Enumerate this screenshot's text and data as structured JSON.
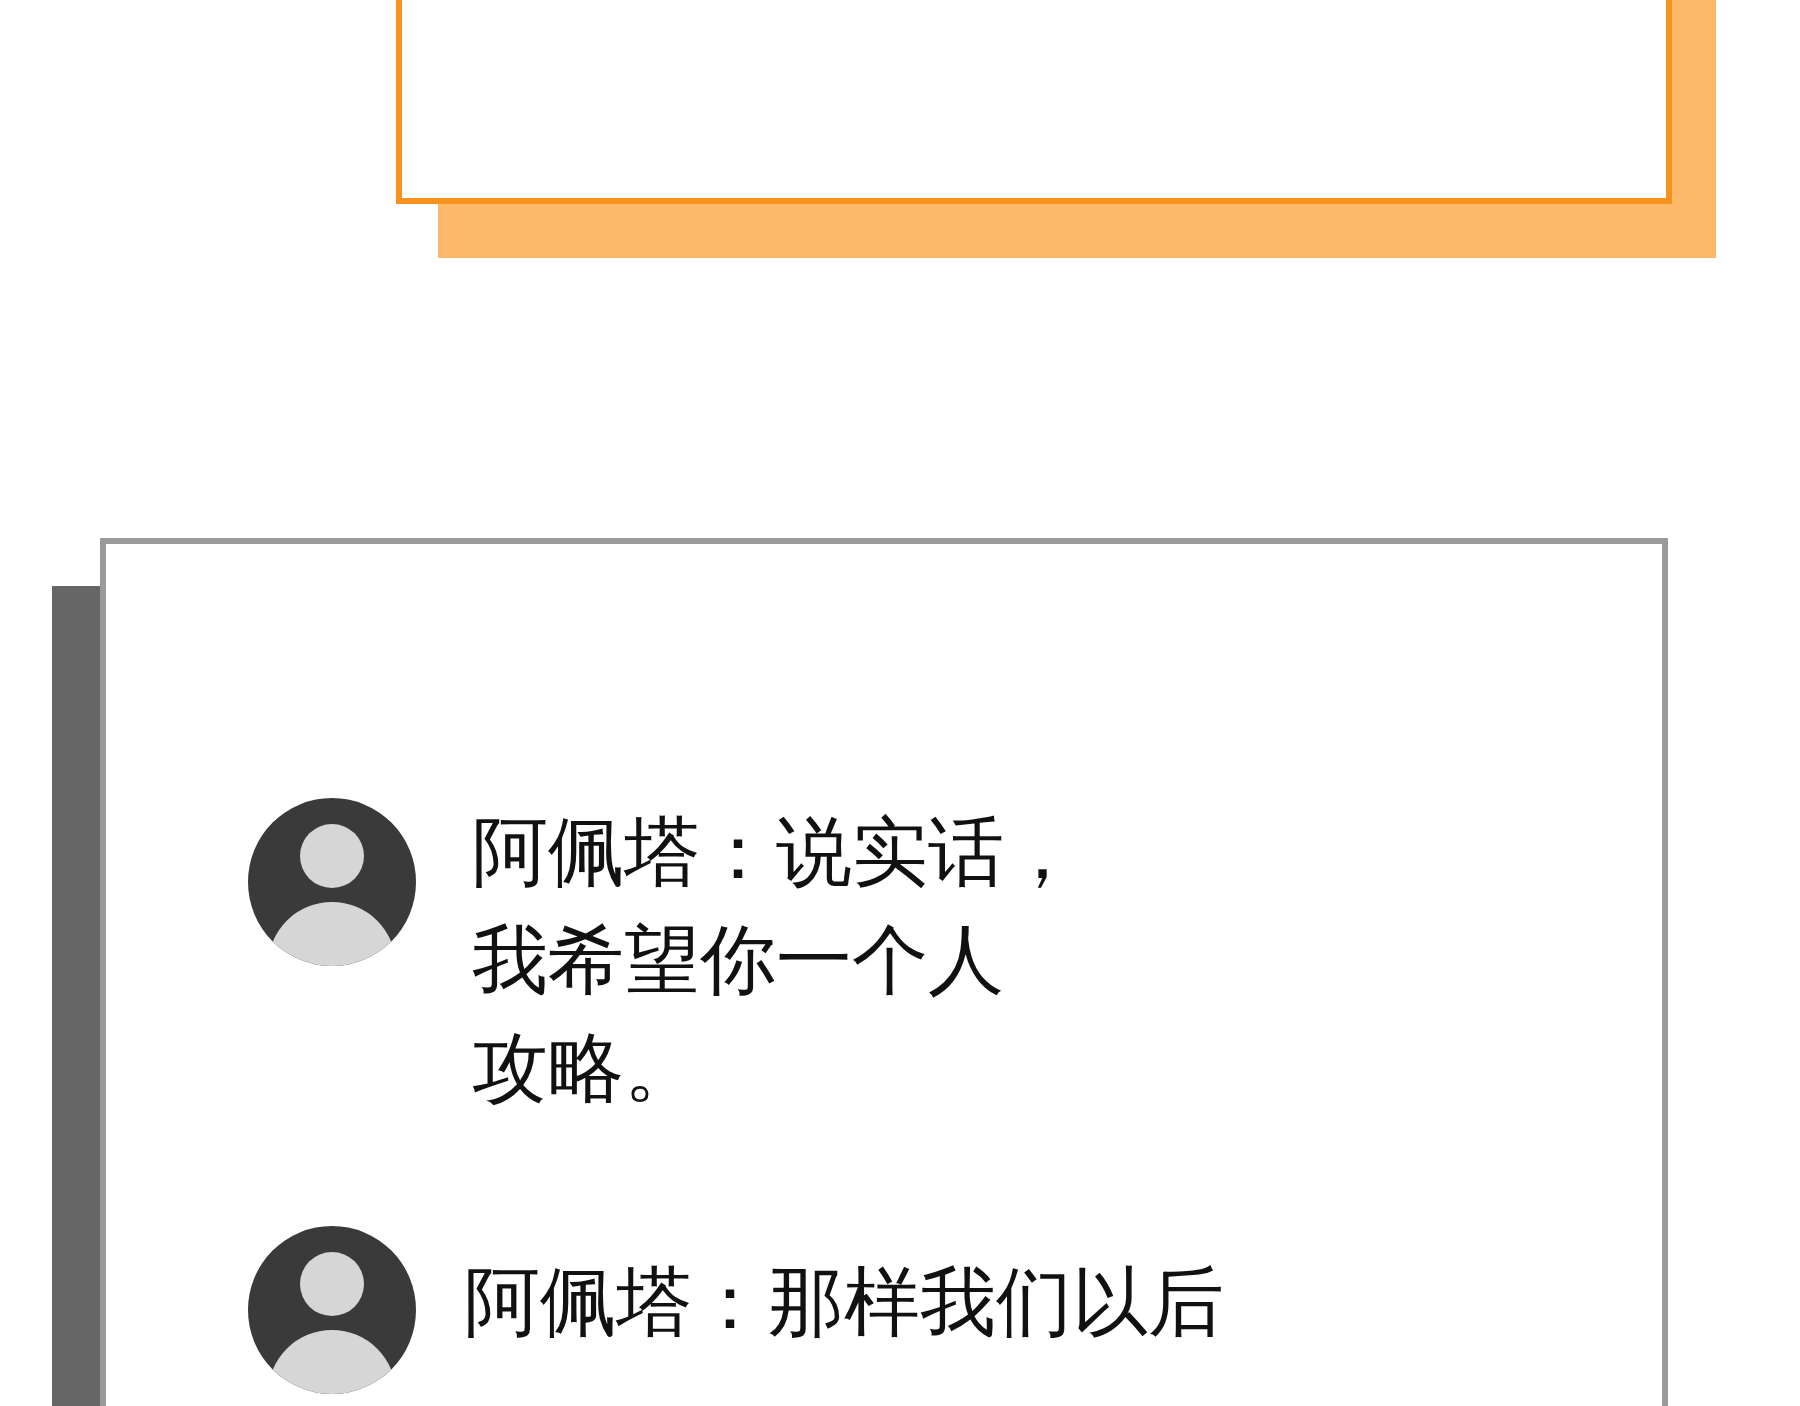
{
  "messages": [
    {
      "lines": [
        "阿佩塔：说实话，",
        "我希望你一个人",
        "攻略。"
      ]
    },
    {
      "lines": [
        "阿佩塔：那样我们以后"
      ]
    }
  ]
}
